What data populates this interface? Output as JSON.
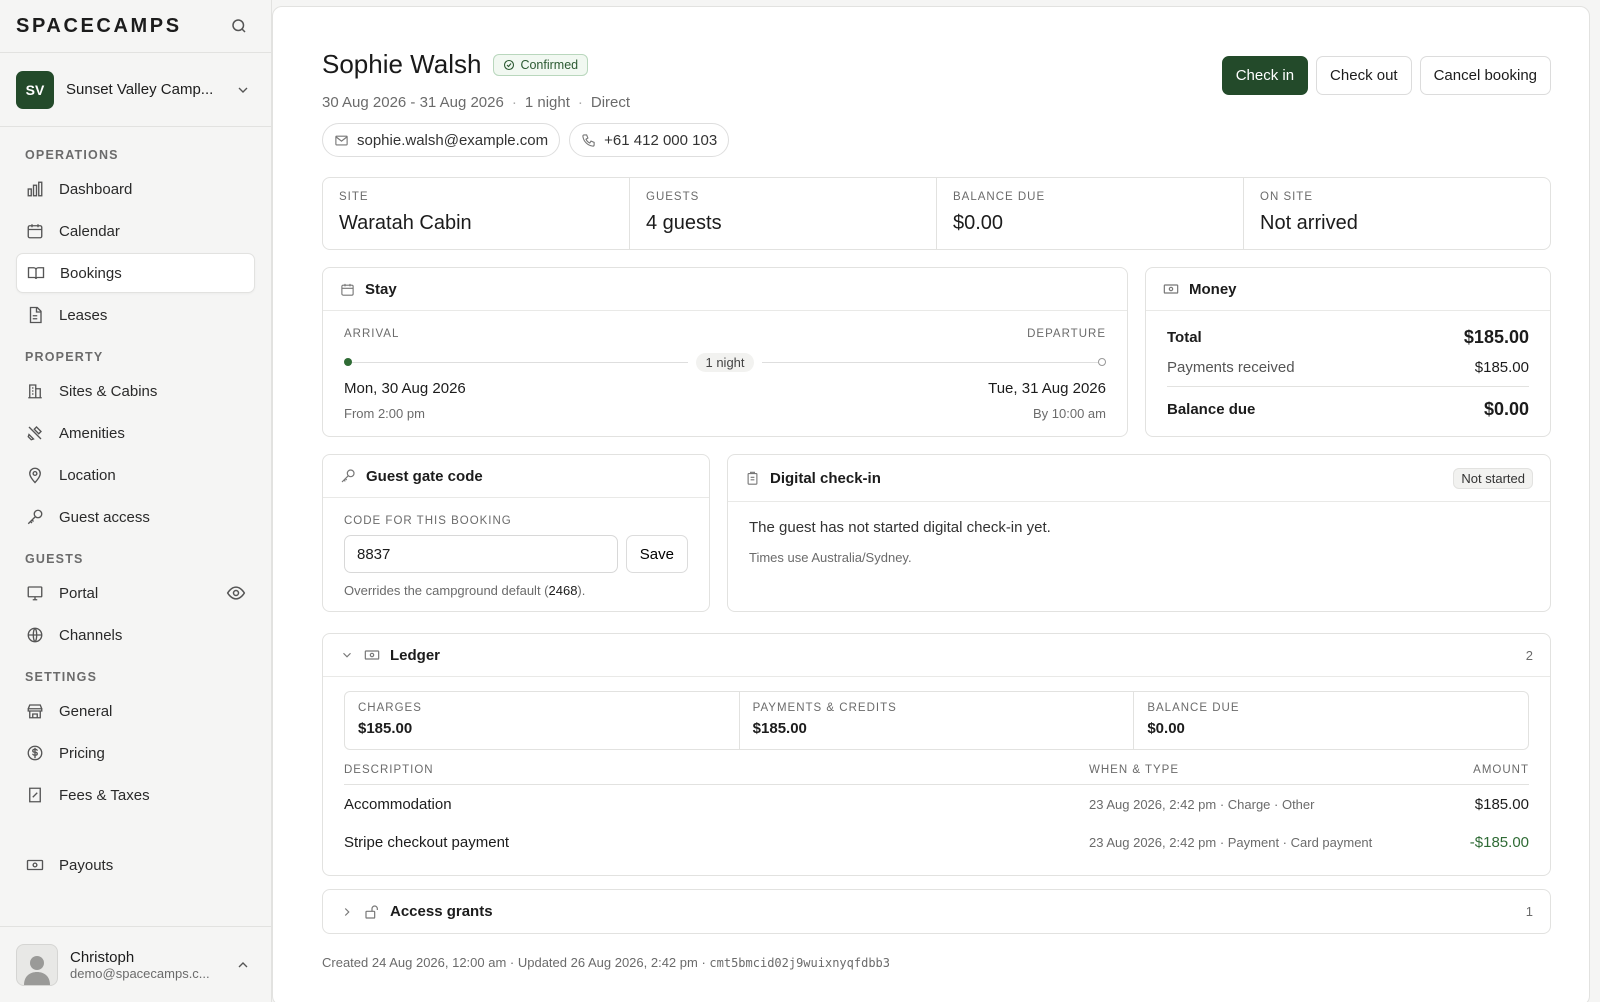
{
  "brand": {
    "name": "SPACECAMPS"
  },
  "campground": {
    "initials": "SV",
    "name": "Sunset Valley Camp..."
  },
  "nav": {
    "operations_label": "OPERATIONS",
    "operations": [
      {
        "label": "Dashboard",
        "icon": "bar-chart-icon"
      },
      {
        "label": "Calendar",
        "icon": "calendar-icon"
      },
      {
        "label": "Bookings",
        "icon": "book-icon",
        "active": true
      },
      {
        "label": "Leases",
        "icon": "document-icon"
      }
    ],
    "property_label": "PROPERTY",
    "property": [
      {
        "label": "Sites & Cabins",
        "icon": "building-icon"
      },
      {
        "label": "Amenities",
        "icon": "tools-icon"
      },
      {
        "label": "Location",
        "icon": "map-pin-icon"
      },
      {
        "label": "Guest access",
        "icon": "key-icon"
      }
    ],
    "guests_label": "GUESTS",
    "guests": [
      {
        "label": "Portal",
        "icon": "monitor-icon"
      },
      {
        "label": "Channels",
        "icon": "globe-icon"
      }
    ],
    "settings_label": "SETTINGS",
    "settings": [
      {
        "label": "General",
        "icon": "store-icon"
      },
      {
        "label": "Pricing",
        "icon": "dollar-circle-icon"
      },
      {
        "label": "Fees & Taxes",
        "icon": "receipt-icon"
      }
    ],
    "payouts": {
      "label": "Payouts",
      "icon": "banknote-icon"
    }
  },
  "user": {
    "name": "Christoph",
    "email": "demo@spacecamps.c..."
  },
  "booking": {
    "guest_name": "Sophie Walsh",
    "status": "Confirmed",
    "dates": "30 Aug 2026 - 31 Aug 2026",
    "nights": "1 night",
    "source": "Direct",
    "email": "sophie.walsh@example.com",
    "phone": "+61 412 000 103"
  },
  "actions": {
    "check_in": "Check in",
    "check_out": "Check out",
    "cancel": "Cancel booking"
  },
  "stats": [
    {
      "label": "SITE",
      "value": "Waratah Cabin"
    },
    {
      "label": "GUESTS",
      "value": "4 guests"
    },
    {
      "label": "BALANCE DUE",
      "value": "$0.00"
    },
    {
      "label": "ON SITE",
      "value": "Not arrived"
    }
  ],
  "stay": {
    "title": "Stay",
    "arrival_label": "ARRIVAL",
    "departure_label": "DEPARTURE",
    "nights": "1 night",
    "arrival_date": "Mon, 30 Aug 2026",
    "arrival_time": "From 2:00 pm",
    "departure_date": "Tue, 31 Aug 2026",
    "departure_time": "By 10:00 am"
  },
  "money": {
    "title": "Money",
    "total_label": "Total",
    "total": "$185.00",
    "received_label": "Payments received",
    "received": "$185.00",
    "due_label": "Balance due",
    "due": "$0.00"
  },
  "gate": {
    "title": "Guest gate code",
    "label": "CODE FOR THIS BOOKING",
    "value": "8837",
    "save": "Save",
    "note_prefix": "Overrides the campground default (",
    "default_code": "2468",
    "note_suffix": ")."
  },
  "digital": {
    "title": "Digital check-in",
    "status": "Not started",
    "message": "The guest has not started digital check-in yet.",
    "timezone": "Times use Australia/Sydney."
  },
  "ledger": {
    "title": "Ledger",
    "count": "2",
    "charges_label": "CHARGES",
    "charges": "$185.00",
    "payments_label": "PAYMENTS & CREDITS",
    "payments": "$185.00",
    "due_label": "BALANCE DUE",
    "due": "$0.00",
    "col_desc": "DESCRIPTION",
    "col_when": "WHEN & TYPE",
    "col_amount": "AMOUNT",
    "rows": [
      {
        "desc": "Accommodation",
        "when": "23 Aug 2026, 2:42 pm · Charge · Other",
        "amount": "$185.00"
      },
      {
        "desc": "Stripe checkout payment",
        "when": "23 Aug 2026, 2:42 pm · Payment · Card payment",
        "amount": "-$185.00"
      }
    ]
  },
  "access": {
    "title": "Access grants",
    "count": "1"
  },
  "footer": {
    "text": "Created 24 Aug 2026, 12:00 am · Updated 26 Aug 2026, 2:42 pm · ",
    "id": "cmt5bmcid02j9wuixnyqfdbb3"
  },
  "colors": {
    "brand_green": "#234a2a",
    "accent_green": "#2f6b35"
  }
}
